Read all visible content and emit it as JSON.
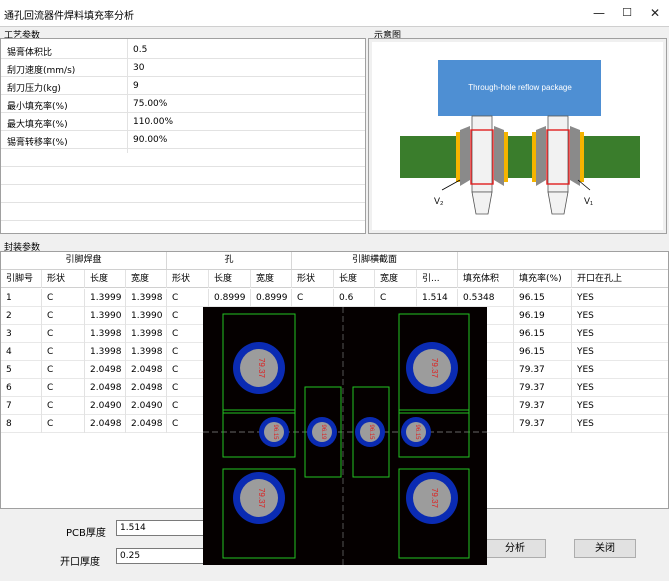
{
  "window": {
    "title": "通孔回流器件焊料填充率分析",
    "min": "—",
    "max": "☐",
    "close": "✕"
  },
  "process": {
    "group_label": "工艺参数",
    "rows": [
      {
        "label": "锡膏体积比",
        "value": "0.5"
      },
      {
        "label": "刮刀速度(mm/s)",
        "value": "30"
      },
      {
        "label": "刮刀压力(kg)",
        "value": "9"
      },
      {
        "label": "最小填充率(%)",
        "value": "75.00%"
      },
      {
        "label": "最大填充率(%)",
        "value": "110.00%"
      },
      {
        "label": "锡膏转移率(%)",
        "value": "90.00%"
      }
    ]
  },
  "diagram": {
    "group_label": "示意图",
    "package_label": "Through-hole reflow package",
    "left_marker": "V₂",
    "right_marker": "V₁",
    "colors": {
      "package": "#4e8fd3",
      "board": "#3a7d2c",
      "pad": "#f5b400",
      "pin": "#f2f2f2",
      "barrel": "#e02020"
    }
  },
  "package": {
    "group_label": "封装参数",
    "groups": [
      "引脚焊盘",
      "孔",
      "引脚横截面"
    ],
    "columns": [
      "引脚号",
      "形状",
      "长度",
      "宽度",
      "形状",
      "长度",
      "宽度",
      "形状",
      "长度",
      "宽度",
      "引...",
      "填充体积",
      "填充率(%)",
      "开口在孔上"
    ],
    "rows": [
      [
        "1",
        "C",
        "1.3999",
        "1.3998",
        "C",
        "0.8999",
        "0.8999",
        "C",
        "0.6",
        "C",
        "1.514",
        "0.5348",
        "96.15",
        "YES"
      ],
      [
        "2",
        "C",
        "1.3990",
        "1.3990",
        "C",
        "",
        "",
        "",
        "",
        "",
        "",
        "...49",
        "96.19",
        "YES"
      ],
      [
        "3",
        "C",
        "1.3998",
        "1.3998",
        "C",
        "",
        "",
        "",
        "",
        "",
        "",
        "...49",
        "96.15",
        "YES"
      ],
      [
        "4",
        "C",
        "1.3998",
        "1.3998",
        "C",
        "",
        "",
        "",
        "",
        "",
        "",
        "...49",
        "96.15",
        "YES"
      ],
      [
        "5",
        "C",
        "2.0498",
        "2.0498",
        "C",
        "",
        "",
        "",
        "",
        "",
        "",
        "...05",
        "79.37",
        "YES"
      ],
      [
        "6",
        "C",
        "2.0498",
        "2.0498",
        "C",
        "",
        "",
        "",
        "",
        "",
        "",
        "...05",
        "79.37",
        "YES"
      ],
      [
        "7",
        "C",
        "2.0490",
        "2.0490",
        "C",
        "",
        "",
        "",
        "",
        "",
        "",
        "...05",
        "79.37",
        "YES"
      ],
      [
        "8",
        "C",
        "2.0498",
        "2.0498",
        "C",
        "",
        "",
        "",
        "",
        "",
        "",
        "...05",
        "79.37",
        "YES"
      ]
    ]
  },
  "overlay": {
    "large_labels": [
      "79.37",
      "79.37",
      "79.37",
      "79.37"
    ],
    "small_labels": [
      "96.15",
      "96.19",
      "96.15",
      "96.15"
    ]
  },
  "bottom": {
    "pcb_label": "PCB厚度",
    "pcb_value": "1.514",
    "opening_label": "开口厚度",
    "opening_value": "0.25",
    "analyze": "分析",
    "close": "关闭"
  }
}
